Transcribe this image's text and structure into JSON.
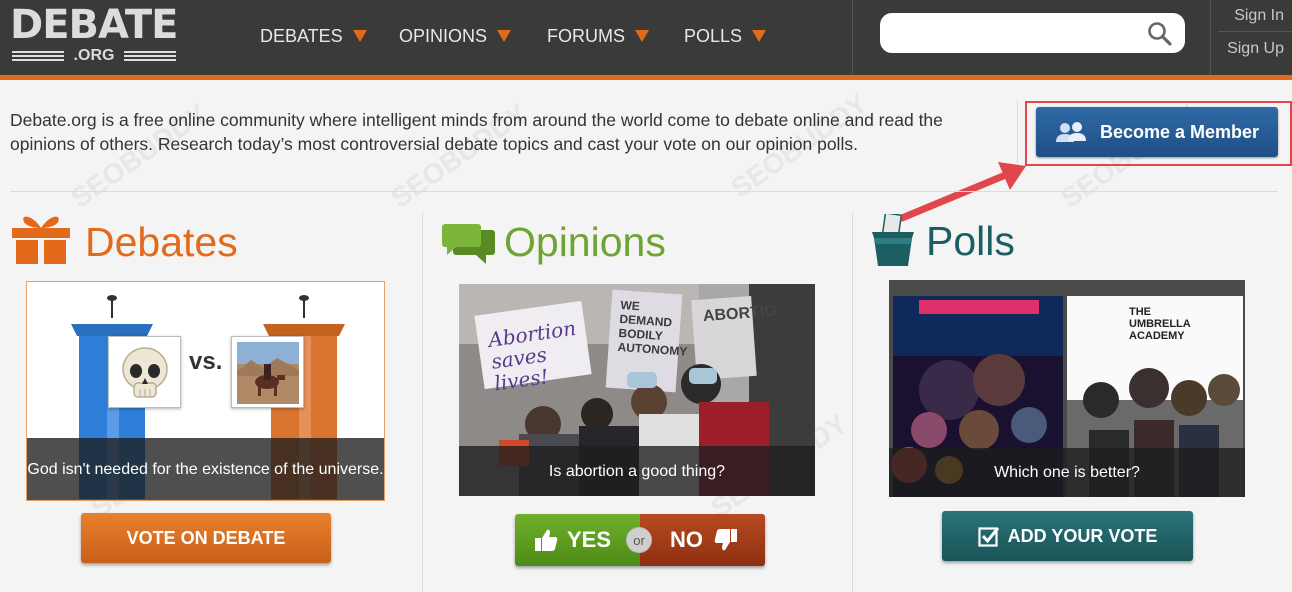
{
  "header": {
    "logo": {
      "main": "DEBATE",
      "sub": ".ORG"
    },
    "nav": [
      {
        "label": "DEBATES"
      },
      {
        "label": "OPINIONS"
      },
      {
        "label": "FORUMS"
      },
      {
        "label": "POLLS"
      }
    ],
    "search": {
      "placeholder": "",
      "value": ""
    },
    "sign_in": "Sign In",
    "sign_up": "Sign Up"
  },
  "intro": {
    "text": "Debate.org is a free online community where intelligent minds from around the world come to debate online and read the opinions of others. Research today’s most controversial debate topics and cast your vote on our opinion polls."
  },
  "member_button": {
    "label": "Become a Member"
  },
  "sections": {
    "debates": {
      "title": "Debates",
      "vs": "vs.",
      "caption": "God isn't needed for the existence of the universe.",
      "button": "VOTE ON DEBATE"
    },
    "opinions": {
      "title": "Opinions",
      "sign1": "Abortion saves lives!",
      "sign2": "WE DEMAND BODILY AUTONOMY",
      "sign3": "ABORTIO",
      "caption": "Is abortion a good thing?",
      "yes": "YES",
      "or": "or",
      "no": "NO"
    },
    "polls": {
      "title": "Polls",
      "poster_title": "THE UMBRELLA ACADEMY",
      "caption": "Which one is better?",
      "button": "ADD YOUR VOTE"
    }
  },
  "watermark": "SEOBUDDY",
  "colors": {
    "header_bg": "#3a3a3a",
    "accent_orange": "#e36a1a",
    "debates": "#e36a1a",
    "opinions": "#6fa333",
    "polls": "#1c5f63",
    "member_blue": "#2a5f98",
    "highlight_red": "#e0474c"
  }
}
